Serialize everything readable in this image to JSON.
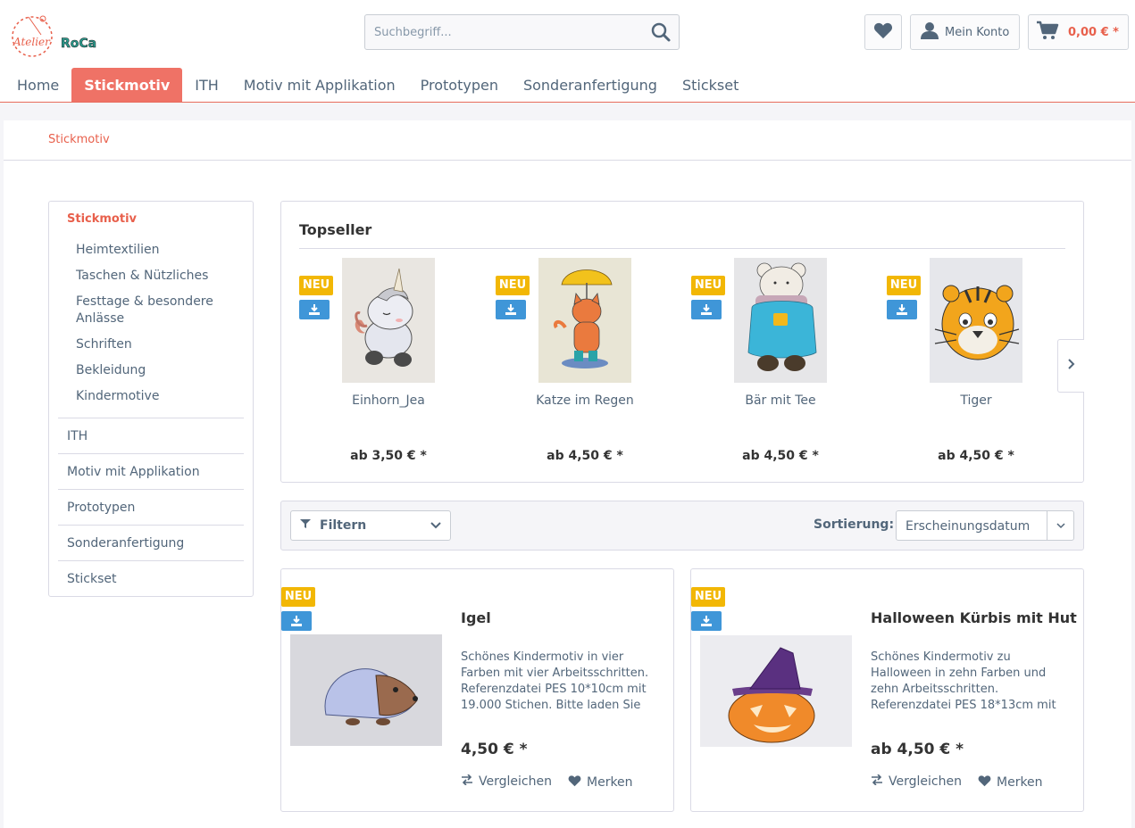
{
  "brand": {
    "logo_text_1": "Atelier",
    "logo_text_2": "RoCa"
  },
  "search": {
    "placeholder": "Suchbegriff..."
  },
  "header": {
    "account_label": "Mein Konto",
    "cart_total": "0,00 € *"
  },
  "nav": [
    {
      "label": "Home"
    },
    {
      "label": "Stickmotiv",
      "active": true
    },
    {
      "label": "ITH"
    },
    {
      "label": "Motiv mit Applikation"
    },
    {
      "label": "Prototypen"
    },
    {
      "label": "Sonderanfertigung"
    },
    {
      "label": "Stickset"
    }
  ],
  "breadcrumb": "Stickmotiv",
  "sidebar": {
    "active": "Stickmotiv",
    "subitems": [
      "Heimtextilien",
      "Taschen & Nützliches",
      "Festtage & besondere Anlässe",
      "Schriften",
      "Bekleidung",
      "Kindermotive"
    ],
    "categories": [
      "ITH",
      "Motiv mit Applikation",
      "Prototypen",
      "Sonderanfertigung",
      "Stickset"
    ]
  },
  "topseller": {
    "title": "Topseller",
    "badge": "NEU",
    "items": [
      {
        "name": "Einhorn_Jea",
        "price": "ab 3,50 € *"
      },
      {
        "name": "Katze im Regen",
        "price": "ab 4,50 € *"
      },
      {
        "name": "Bär mit Tee",
        "price": "ab 4,50 € *"
      },
      {
        "name": "Tiger",
        "price": "ab 4,50 € *"
      }
    ]
  },
  "filter": {
    "label": "Filtern",
    "sort_label": "Sortierung:",
    "sort_value": "Erscheinungsdatum"
  },
  "products": [
    {
      "badge": "NEU",
      "title": "Igel",
      "description": "Schönes Kindermotiv in vier Farben mit vier Arbeitsschritten. Referenzdatei PES 10*10cm mit 19.000 Stichen. Bitte laden Sie sich",
      "price": "4,50 € *",
      "compare": "Vergleichen",
      "wishlist": "Merken"
    },
    {
      "badge": "NEU",
      "title": "Halloween Kürbis mit Hut",
      "description": "Schönes Kindermotiv zu Halloween in zehn Farben und zehn Arbeitsschritten. Referenzdatei PES 18*13cm mit",
      "price": "ab 4,50 € *",
      "compare": "Vergleichen",
      "wishlist": "Merken"
    }
  ],
  "colors": {
    "accent": "#e8604c",
    "nav_active": "#ef7266",
    "badge_new": "#f2b705",
    "badge_download": "#3f96d8"
  }
}
